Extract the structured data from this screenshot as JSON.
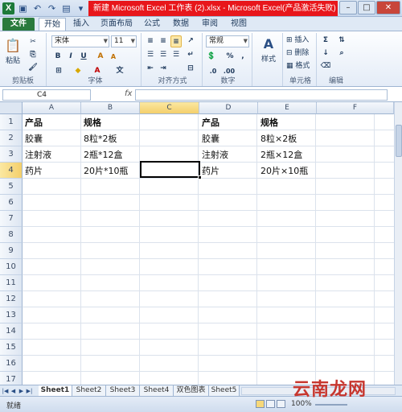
{
  "window": {
    "title": "新建 Microsoft Excel 工作表 (2).xlsx - Microsoft Excel(产品激活失败)"
  },
  "ribbon": {
    "tabs": [
      "文件",
      "开始",
      "插入",
      "页面布局",
      "公式",
      "数据",
      "审阅",
      "视图"
    ],
    "groups": {
      "clipboard": {
        "label": "剪贴板",
        "paste": "粘贴"
      },
      "font": {
        "label": "字体",
        "font_name": "宋体",
        "font_size": "11",
        "bold": "B",
        "italic": "I",
        "underline": "U"
      },
      "alignment": {
        "label": "对齐方式"
      },
      "number": {
        "label": "数字",
        "format": "常规",
        "percent": "%",
        "comma": ","
      },
      "styles": {
        "label": "样式"
      },
      "cells": {
        "label": "单元格",
        "insert": "插入",
        "delete": "删除",
        "format": "格式"
      },
      "editing": {
        "label": "编辑"
      }
    }
  },
  "formula_bar": {
    "name_box": "C4",
    "fx": "fx",
    "formula": ""
  },
  "grid": {
    "columns": [
      "A",
      "B",
      "C",
      "D",
      "E",
      "F"
    ],
    "active_column": "C",
    "rows": [
      "1",
      "2",
      "3",
      "4",
      "5",
      "6",
      "7",
      "8",
      "9",
      "10",
      "11",
      "12",
      "13",
      "14",
      "15",
      "16",
      "17"
    ],
    "active_row": "4",
    "cells": {
      "A1": "产品",
      "B1": "规格",
      "D1": "产品",
      "E1": "规格",
      "A2": "胶囊",
      "B2": "8粒*2板",
      "D2": "胶囊",
      "E2": "8粒×2板",
      "A3": "注射液",
      "B3": "2瓶*12盒",
      "D3": "注射液",
      "E3": "2瓶×12盒",
      "A4": "药片",
      "B4": "20片*10瓶",
      "D4": "药片",
      "E4": "20片×10瓶"
    },
    "selected_cell": "C4"
  },
  "sheets": [
    "Sheet1",
    "Sheet2",
    "Sheet3",
    "Sheet4",
    "双色图表",
    "Sheet5"
  ],
  "status": {
    "ready": "就绪",
    "zoom": "100%"
  },
  "watermark": "云南龙网"
}
